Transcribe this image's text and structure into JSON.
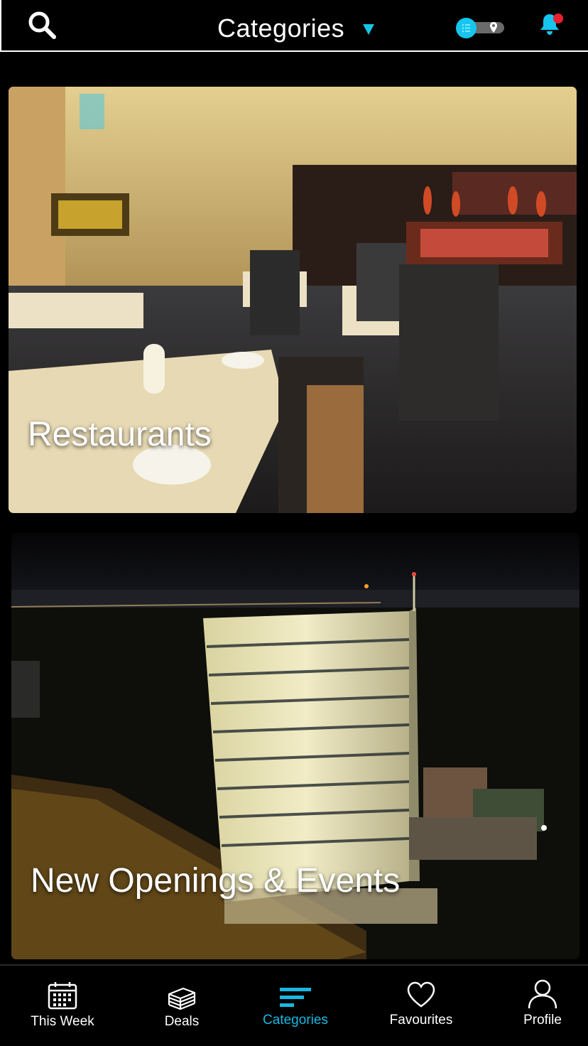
{
  "header": {
    "title": "Categories",
    "search_icon": "search-icon",
    "caret_icon": "caret-down-icon",
    "toggle_state": "list",
    "notification_icon": "bell-icon",
    "notification_badge_color": "#e8202f",
    "accent_color": "#16c6ee"
  },
  "categories": [
    {
      "label": "Restaurants",
      "image": "restaurant-dining-room-photo"
    },
    {
      "label": "New Openings & Events",
      "image": "night-city-building-photo"
    }
  ],
  "tabbar": {
    "tabs": [
      {
        "label": "This Week",
        "icon": "calendar-icon",
        "active": false
      },
      {
        "label": "Deals",
        "icon": "stack-icon",
        "active": false
      },
      {
        "label": "Categories",
        "icon": "categories-lines-icon",
        "active": true
      },
      {
        "label": "Favourites",
        "icon": "heart-icon",
        "active": false
      },
      {
        "label": "Profile",
        "icon": "user-icon",
        "active": false
      }
    ],
    "active_color": "#17b9e3"
  }
}
